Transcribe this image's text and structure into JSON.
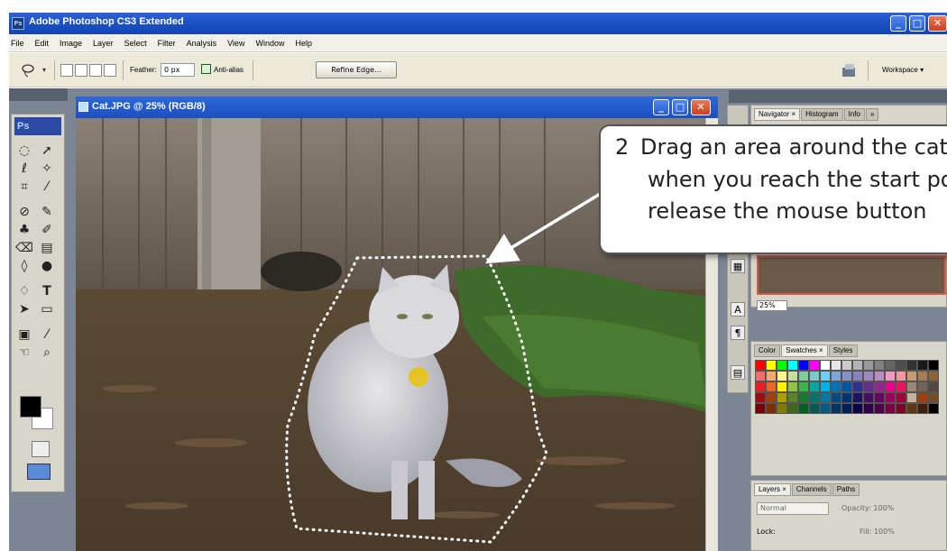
{
  "app": {
    "icon_label": "Ps",
    "title": "Adobe Photoshop CS3 Extended"
  },
  "menu": [
    "File",
    "Edit",
    "Image",
    "Layer",
    "Select",
    "Filter",
    "Analysis",
    "View",
    "Window",
    "Help"
  ],
  "options": {
    "feather_label": "Feather:",
    "feather_value": "0 px",
    "antialias_label": "Anti-alias",
    "refine_edge": "Refine Edge...",
    "workspace_label": "Workspace ▾"
  },
  "tools": {
    "logo": "Ps"
  },
  "document": {
    "title": "Cat.JPG @ 25% (RGB/8)"
  },
  "panels": {
    "top_tabs": [
      "Navigator ×",
      "Histogram",
      "Info",
      "»"
    ],
    "zoom_value": "25%",
    "color_tabs": [
      "Color",
      "Swatches ×",
      "Styles"
    ],
    "layers_tabs": [
      "Layers ×",
      "Channels",
      "Paths"
    ],
    "layers_blend": "Normal",
    "layers_opacity": "Opacity: 100%",
    "layers_lock": "Lock:",
    "layers_fill": "Fill: 100%"
  },
  "callout": {
    "number": "2",
    "line1": "Drag an area around the cat,",
    "line2": "when you reach the start point",
    "line3": "release the mouse button"
  },
  "colors": {
    "titlebar": "#1a4ec0",
    "workspace": "#7c8594",
    "selection": "#ffffff"
  }
}
